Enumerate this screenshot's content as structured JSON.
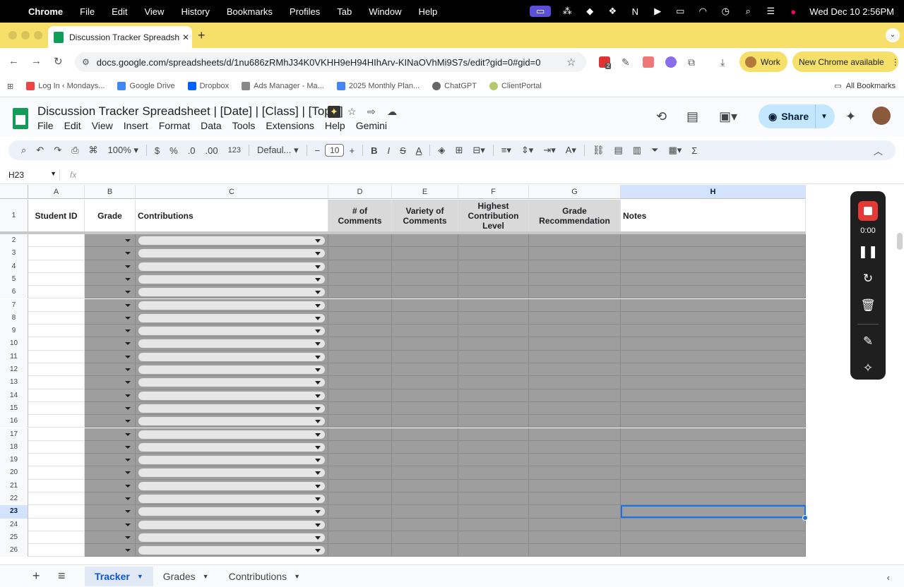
{
  "macos_menubar": {
    "apple": "",
    "app": "Chrome",
    "items": [
      "File",
      "Edit",
      "View",
      "History",
      "Bookmarks",
      "Profiles",
      "Tab",
      "Window",
      "Help"
    ],
    "clock": "Wed Dec 10  2:56PM"
  },
  "browser": {
    "tab_title": "Discussion Tracker Spreadsheet",
    "url": "docs.google.com/spreadsheets/d/1nu686zRMhJ34K0VKHH9eH94HIhArv-KINaOVhMi9S7s/edit?gid=0#gid=0",
    "extension_badge": "2",
    "profile_label": "Work",
    "update_label": "New Chrome available",
    "bookmarks": [
      {
        "label": "Log In ‹ Mondays...",
        "color": "#e44"
      },
      {
        "label": "Google Drive",
        "color": "#4285f4"
      },
      {
        "label": "Dropbox",
        "color": "#0061ff"
      },
      {
        "label": "Ads Manager - Ma...",
        "color": "#888"
      },
      {
        "label": "2025 Monthly Plan...",
        "color": "#4285f4"
      },
      {
        "label": "ChatGPT",
        "color": "#666"
      },
      {
        "label": "ClientPortal",
        "color": "#b5c96a"
      }
    ],
    "all_bookmarks_label": "All Bookmarks"
  },
  "sheets": {
    "title": "Discussion Tracker Spreadsheet | [Date] | [Class] | [Topic]",
    "menu": [
      "File",
      "Edit",
      "View",
      "Insert",
      "Format",
      "Data",
      "Tools",
      "Extensions",
      "Help",
      "Gemini"
    ],
    "share_label": "Share",
    "toolbar": {
      "zoom": "100%",
      "currency": "$",
      "percent": "%",
      "dec_decrease": ".0",
      "dec_increase": ".00",
      "number_format": "123",
      "font": "Defaul...",
      "font_size": "10"
    },
    "namebox": "H23",
    "fx": "fx",
    "columns": [
      {
        "letter": "A",
        "header": "Student ID"
      },
      {
        "letter": "B",
        "header": "Grade"
      },
      {
        "letter": "C",
        "header": "Contributions"
      },
      {
        "letter": "D",
        "header": "# of Comments"
      },
      {
        "letter": "E",
        "header": "Variety of Comments"
      },
      {
        "letter": "F",
        "header": "Highest Contribution Level"
      },
      {
        "letter": "G",
        "header": "Grade Recommendation"
      },
      {
        "letter": "H",
        "header": "Notes"
      }
    ],
    "row_numbers": [
      "1",
      "2",
      "3",
      "4",
      "5",
      "6",
      "7",
      "8",
      "9",
      "10",
      "11",
      "12",
      "13",
      "14",
      "15",
      "16",
      "17",
      "18",
      "19",
      "20",
      "21",
      "22",
      "23",
      "24",
      "25",
      "26"
    ],
    "selected_column": "H",
    "selected_row": "23",
    "sheet_tabs": [
      "Tracker",
      "Grades",
      "Contributions"
    ],
    "active_sheet": "Tracker"
  },
  "recorder": {
    "time": "0:00"
  },
  "colors": {
    "gray_fill": "#9e9e9e",
    "selection_blue": "#1a73e8",
    "tabbar_yellow": "#f6e06a",
    "share_blue": "#c2e7ff"
  }
}
